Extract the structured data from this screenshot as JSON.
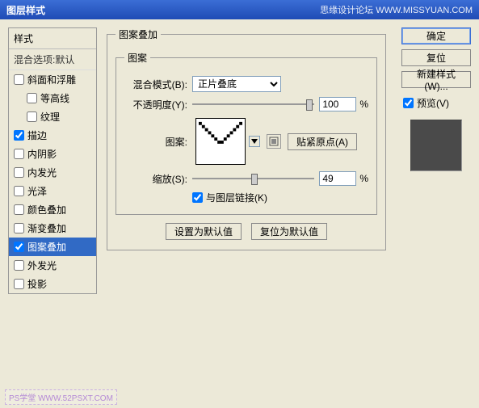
{
  "titlebar": {
    "title": "图层样式",
    "right": "思缘设计论坛  WWW.MISSYUAN.COM"
  },
  "styles": {
    "header": "样式",
    "sub": "混合选项:默认",
    "items": [
      {
        "label": "斜面和浮雕",
        "checked": false,
        "sub": false
      },
      {
        "label": "等高线",
        "checked": false,
        "sub": true
      },
      {
        "label": "纹理",
        "checked": false,
        "sub": true
      },
      {
        "label": "描边",
        "checked": true,
        "sub": false
      },
      {
        "label": "内阴影",
        "checked": false,
        "sub": false
      },
      {
        "label": "内发光",
        "checked": false,
        "sub": false
      },
      {
        "label": "光泽",
        "checked": false,
        "sub": false
      },
      {
        "label": "颜色叠加",
        "checked": false,
        "sub": false
      },
      {
        "label": "渐变叠加",
        "checked": false,
        "sub": false
      },
      {
        "label": "图案叠加",
        "checked": true,
        "sub": false,
        "selected": true
      },
      {
        "label": "外发光",
        "checked": false,
        "sub": false
      },
      {
        "label": "投影",
        "checked": false,
        "sub": false
      }
    ]
  },
  "main": {
    "outer_legend": "图案叠加",
    "inner_legend": "图案",
    "blend_label": "混合模式(B):",
    "blend_value": "正片叠底",
    "opacity_label": "不透明度(Y):",
    "opacity_value": "100",
    "opacity_unit": "%",
    "pattern_label": "图案:",
    "snap_btn": "贴紧原点(A)",
    "scale_label": "缩放(S):",
    "scale_value": "49",
    "scale_unit": "%",
    "link_label": "与图层链接(K)",
    "link_checked": true,
    "default_btn": "设置为默认值",
    "reset_btn": "复位为默认值"
  },
  "right": {
    "ok": "确定",
    "reset": "复位",
    "newstyle": "新建样式(W)...",
    "preview_label": "预览(V)",
    "preview_checked": true
  },
  "watermark": "PS学堂  WWW.52PSXT.COM"
}
